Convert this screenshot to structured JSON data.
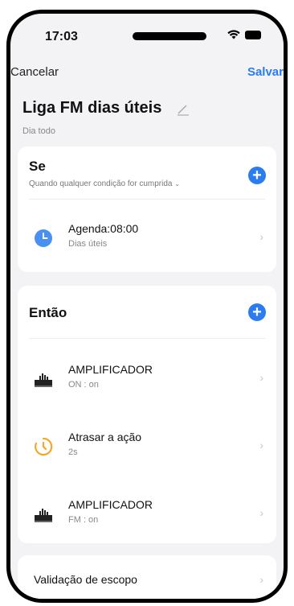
{
  "status": {
    "time": "17:03"
  },
  "nav": {
    "cancel": "Cancelar",
    "save": "Salvar"
  },
  "header": {
    "title": "Liga FM dias úteis",
    "subtitle": "Dia todo"
  },
  "se": {
    "title": "Se",
    "condition": "Quando qualquer condição for cumprida",
    "items": [
      {
        "label": "Agenda:08:00",
        "sub": "Dias úteis",
        "icon": "clock-icon"
      }
    ]
  },
  "entao": {
    "title": "Então",
    "items": [
      {
        "label": "AMPLIFICADOR",
        "sub": "ON : on",
        "icon": "amplifier-icon"
      },
      {
        "label": "Atrasar a ação",
        "sub": "2s",
        "icon": "delay-icon"
      },
      {
        "label": "AMPLIFICADOR",
        "sub": "FM : on",
        "icon": "amplifier-icon"
      }
    ]
  },
  "validation": {
    "label": "Validação de escopo"
  },
  "colors": {
    "accent": "#2b7bf1",
    "delay": "#f0a92a"
  }
}
